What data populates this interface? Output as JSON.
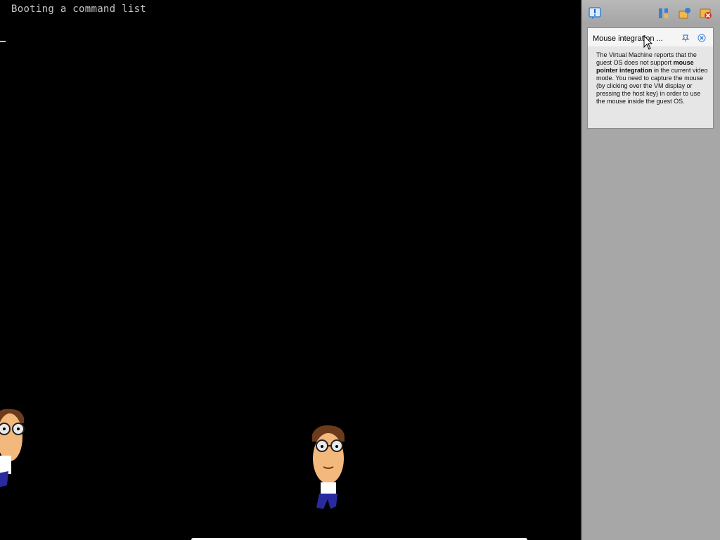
{
  "vm_screen": {
    "boot_text": "Booting a command list"
  },
  "side_panel": {
    "toolbar": {
      "left_icon": "exclamation-bubble-icon",
      "right_icons": [
        "layout-split-icon",
        "pin-message-icon",
        "close-all-messages-icon"
      ]
    },
    "popup": {
      "title": "Mouse integration ...",
      "body_part1": "The Virtual Machine reports that the guest OS does not support ",
      "body_bold": "mouse pointer integration",
      "body_part2": " in the current video mode. You need to capture the mouse (by clicking over the VM display or pressing the host key) in order to use the mouse inside the guest OS."
    }
  },
  "colors": {
    "screen_bg": "#000000",
    "panel_bg": "#a7a7a7",
    "popup_bg": "#e6e6e6",
    "accent": "#3a7fd0"
  }
}
